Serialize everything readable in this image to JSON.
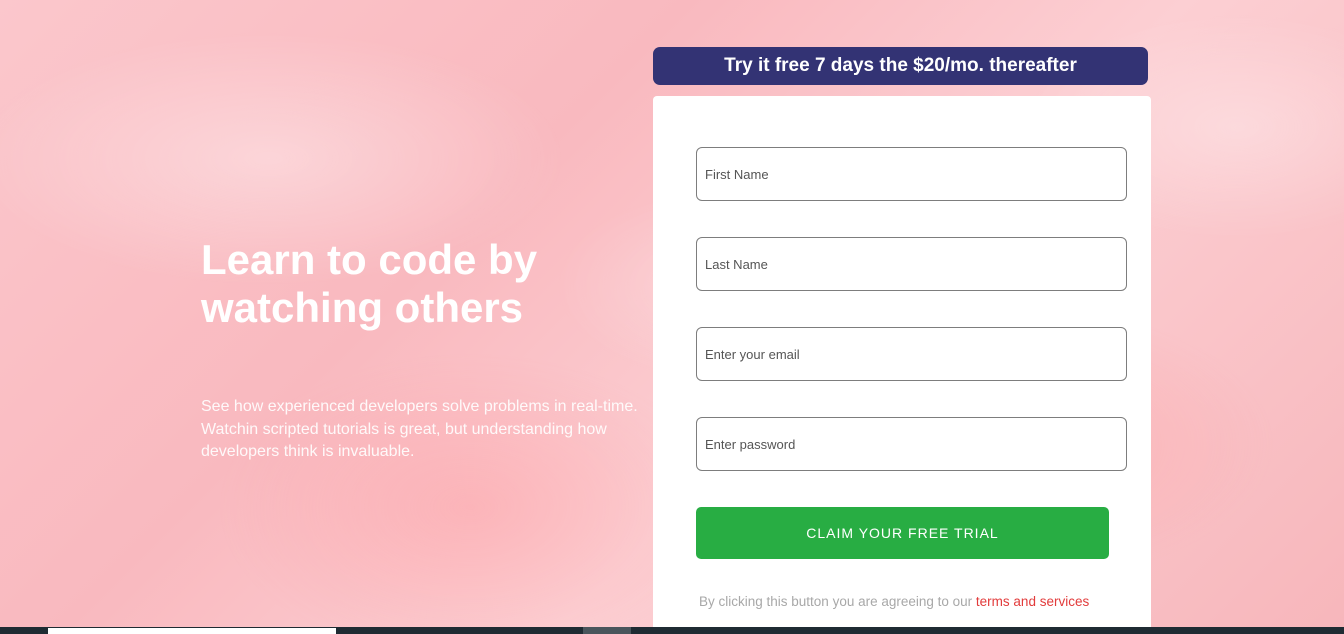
{
  "hero": {
    "title": "Learn to code by watching others",
    "description": "See how experienced developers solve problems in real-time. Watchin scripted tutorials is great, but understanding how developers think is invaluable."
  },
  "promo": {
    "text": "Try it free 7 days the $20/mo. thereafter"
  },
  "form": {
    "first_name_placeholder": "First Name",
    "last_name_placeholder": "Last Name",
    "email_placeholder": "Enter your email",
    "password_placeholder": "Enter password",
    "submit_label": "CLAIM YOUR FREE TRIAL",
    "terms_prefix": "By clicking this button you are agreeing to our ",
    "terms_link": "terms and services"
  },
  "colors": {
    "banner_bg": "#333374",
    "button_bg": "#28ad43",
    "link": "#e23b3b",
    "background": "#fbc7cc"
  }
}
